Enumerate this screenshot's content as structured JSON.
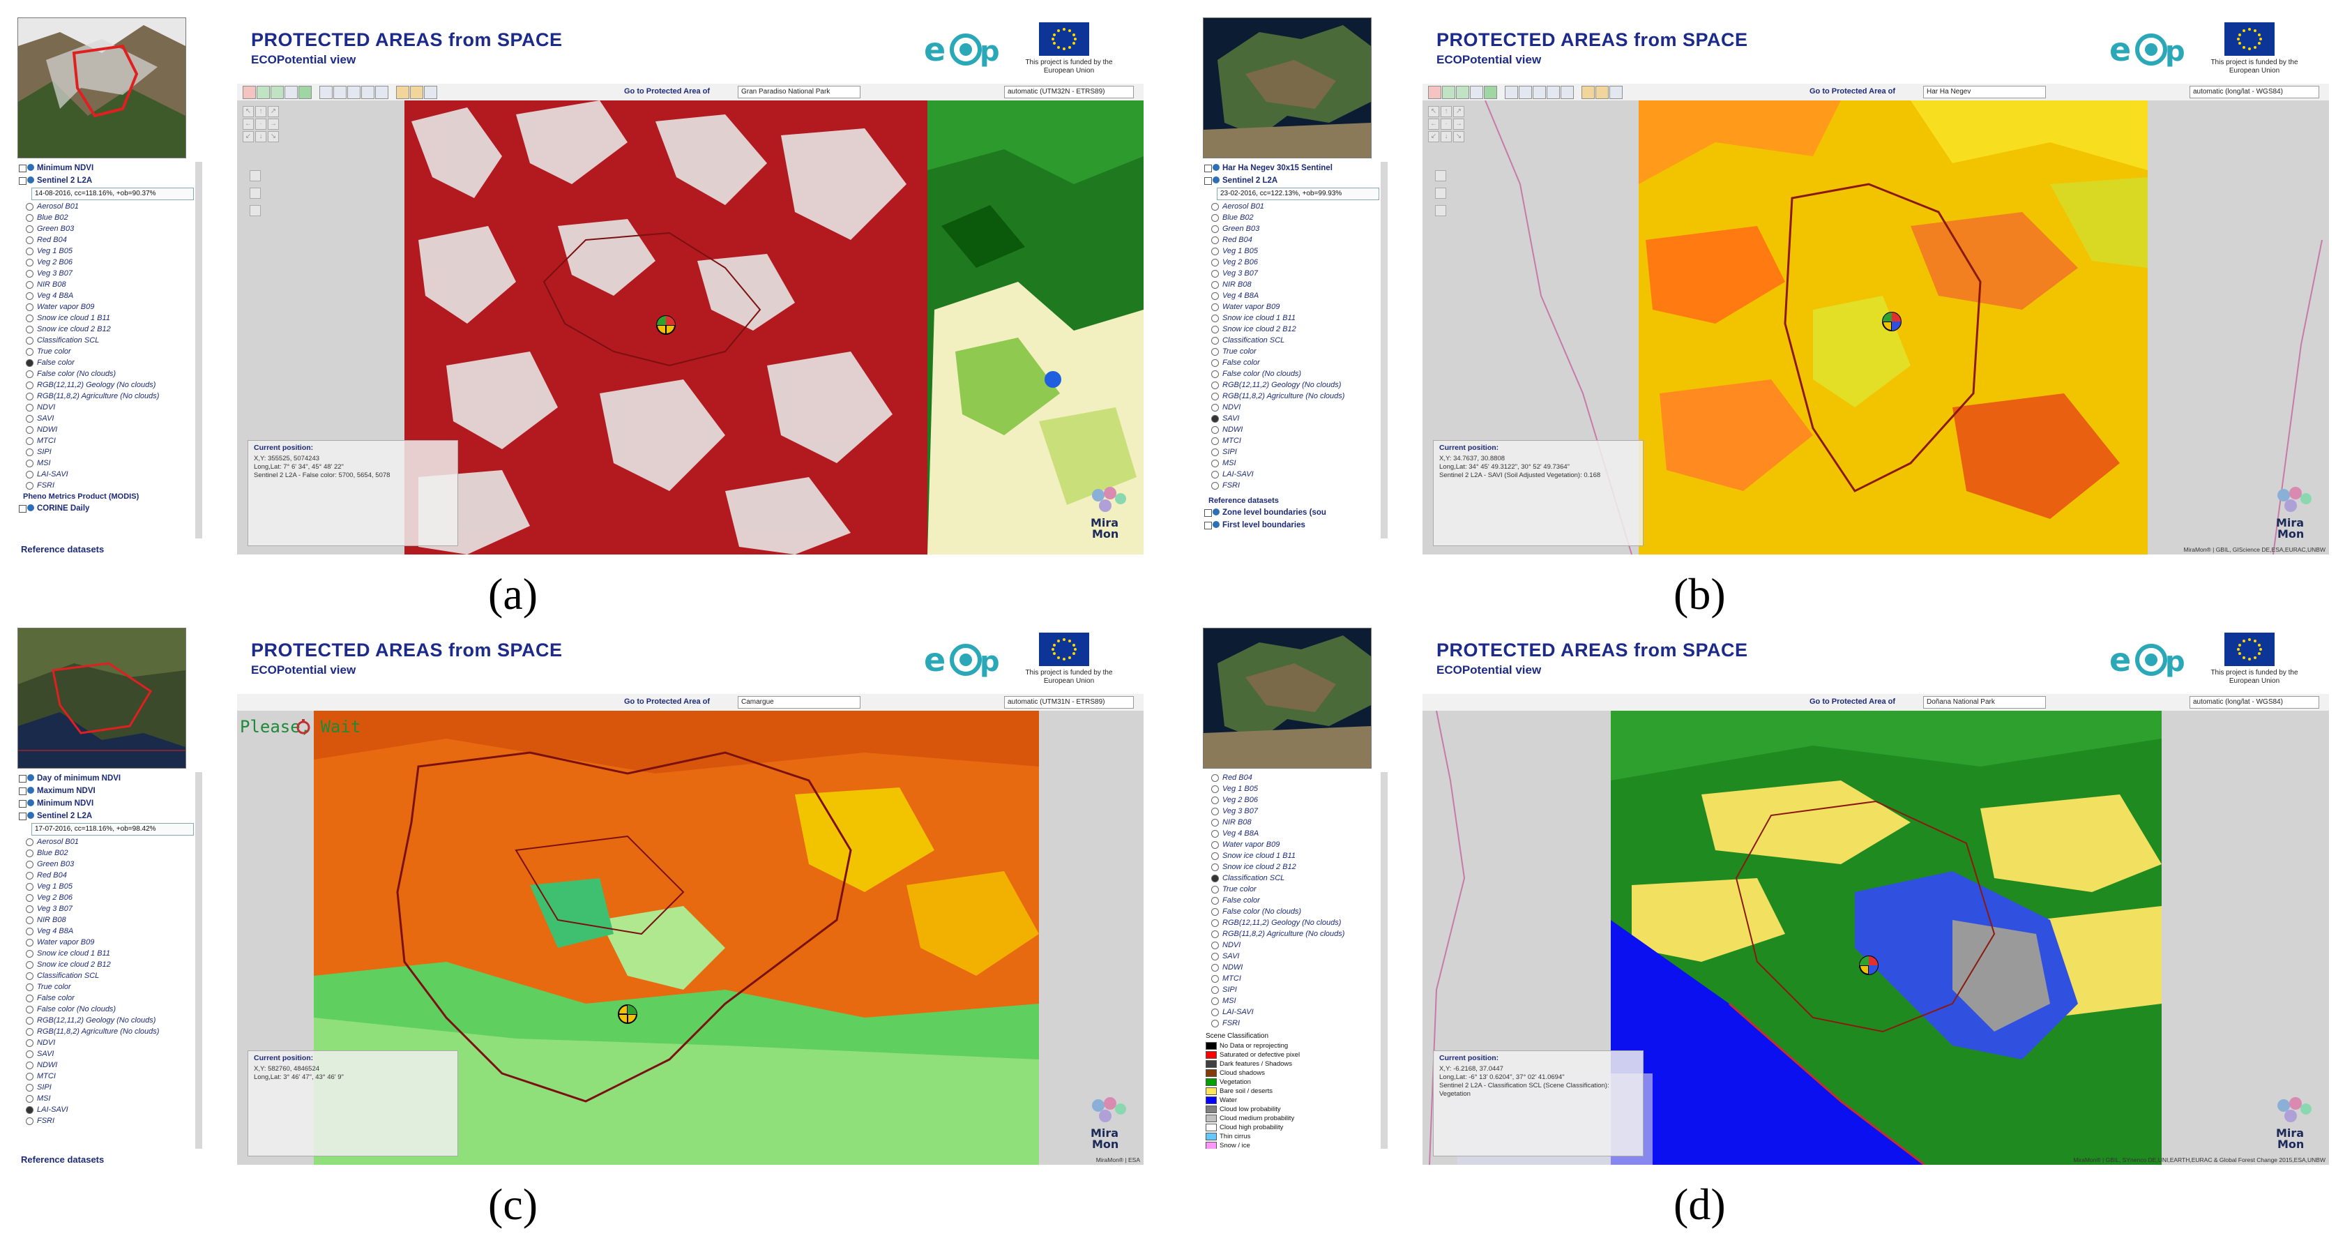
{
  "panels": {
    "a": {
      "caption": "(a)",
      "header": {
        "title": "PROTECTED AREAS from SPACE",
        "subtitle": "ECOPotential view"
      },
      "eu_text": "This project is funded by the European Union",
      "goto_label": "Go to Protected Area of",
      "goto_value": "Gran Paradiso National Park",
      "projection": "automatic (UTM32N - ETRS89)",
      "sidebar": {
        "groups": [
          "Minimum NDVI",
          "Sentinel 2 L2A"
        ],
        "date": "14-08-2016, cc=118.16%, +ob=90.37%",
        "layers": [
          "Aerosol B01",
          "Blue B02",
          "Green B03",
          "Red B04",
          "Veg 1 B05",
          "Veg 2 B06",
          "Veg 3 B07",
          "NIR B08",
          "Veg 4 B8A",
          "Water vapor B09",
          "Snow ice cloud 1 B11",
          "Snow ice cloud 2 B12",
          "Classification SCL",
          "True color",
          "False color",
          "False color (No clouds)",
          "RGB(12,11,2) Geology (No clouds)",
          "RGB(11,8,2) Agriculture (No clouds)",
          "NDVI",
          "SAVI",
          "NDWI",
          "MTCI",
          "SIPI",
          "MSI",
          "LAI-SAVI",
          "FSRI"
        ],
        "selected_layer": "False color",
        "pheno_title": "Pheno Metrics Product (MODIS)",
        "pheno_item": "CORINE Daily",
        "reference": "Reference datasets"
      },
      "position": {
        "title": "Current position:",
        "text": "X,Y: 355525, 5074243\nLong,Lat: 7° 6' 34\", 45° 48' 22\"\nSentinel 2 L2A - False color: 5700, 5654, 5078"
      },
      "credit": ""
    },
    "b": {
      "caption": "(b)",
      "header": {
        "title": "PROTECTED AREAS from SPACE",
        "subtitle": "ECOPotential view"
      },
      "eu_text": "This project is funded by the European Union",
      "goto_label": "Go to Protected Area of",
      "goto_value": "Har Ha Negev",
      "projection": "automatic (long/lat - WGS84)",
      "sidebar": {
        "groups": [
          "Har Ha Negev 30x15 Sentinel",
          "Sentinel 2 L2A"
        ],
        "date": "23-02-2016, cc=122.13%, +ob=99.93%",
        "layers": [
          "Aerosol B01",
          "Blue B02",
          "Green B03",
          "Red B04",
          "Veg 1 B05",
          "Veg 2 B06",
          "Veg 3 B07",
          "NIR B08",
          "Veg 4 B8A",
          "Water vapor B09",
          "Snow ice cloud 1 B11",
          "Snow ice cloud 2 B12",
          "Classification SCL",
          "True color",
          "False color",
          "False color (No clouds)",
          "RGB(12,11,2) Geology (No clouds)",
          "RGB(11,8,2) Agriculture (No clouds)",
          "NDVI",
          "SAVI",
          "NDWI",
          "MTCI",
          "SIPI",
          "MSI",
          "LAI-SAVI",
          "FSRI"
        ],
        "selected_layer": "SAVI",
        "reference": "Reference datasets",
        "ref_items": [
          "Zone level boundaries (sou",
          "First level boundaries"
        ]
      },
      "position": {
        "title": "Current position:",
        "text": "X,Y: 34.7637, 30.8808\nLong,Lat: 34° 45' 49.3122\", 30° 52' 49.7364\"\nSentinel 2 L2A - SAVI (Soil Adjusted Vegetation): 0.168"
      },
      "credit": "MiraMon® | GBIL, GIScience DE,ESA,EURAC,UNBW"
    },
    "c": {
      "caption": "(c)",
      "header": {
        "title": "PROTECTED AREAS from SPACE",
        "subtitle": "ECOPotential view"
      },
      "eu_text": "This project is funded by the European Union",
      "goto_label": "Go to Protected Area of",
      "goto_value": "Camargue",
      "projection": "automatic (UTM31N - ETRS89)",
      "please_wait": "Please, Wait",
      "sidebar": {
        "groups": [
          "Day of minimum NDVI",
          "Maximum NDVI",
          "Minimum NDVI",
          "Sentinel 2 L2A"
        ],
        "date": "17-07-2016, cc=118.16%, +ob=98.42%",
        "layers": [
          "Aerosol B01",
          "Blue B02",
          "Green B03",
          "Red B04",
          "Veg 1 B05",
          "Veg 2 B06",
          "Veg 3 B07",
          "NIR B08",
          "Veg 4 B8A",
          "Water vapor B09",
          "Snow ice cloud 1 B11",
          "Snow ice cloud 2 B12",
          "Classification SCL",
          "True color",
          "False color",
          "False color (No clouds)",
          "RGB(12,11,2) Geology (No clouds)",
          "RGB(11,8,2) Agriculture (No clouds)",
          "NDVI",
          "SAVI",
          "NDWI",
          "MTCI",
          "SIPI",
          "MSI",
          "LAI-SAVI",
          "FSRI"
        ],
        "selected_layer": "LAI-SAVI",
        "reference": "Reference datasets"
      },
      "position": {
        "title": "Current position:",
        "text": "X,Y: 582760, 4846524\nLong,Lat: 3° 46' 47\", 43° 46' 9\""
      },
      "credit": "MiraMon® | ESA"
    },
    "d": {
      "caption": "(d)",
      "header": {
        "title": "PROTECTED AREAS from SPACE",
        "subtitle": "ECOPotential view"
      },
      "eu_text": "This project is funded by the European Union",
      "goto_label": "Go to Protected Area of",
      "goto_value": "Doñana National Park",
      "projection": "automatic (long/lat - WGS84)",
      "sidebar": {
        "layers": [
          "Red B04",
          "Veg 1 B05",
          "Veg 2 B06",
          "Veg 3 B07",
          "NIR B08",
          "Veg 4 B8A",
          "Water vapor B09",
          "Snow ice cloud 1 B11",
          "Snow ice cloud 2 B12",
          "Classification SCL",
          "True color",
          "False color",
          "False color (No clouds)",
          "RGB(12,11,2) Geology (No clouds)",
          "RGB(11,8,2) Agriculture (No clouds)",
          "NDVI",
          "SAVI",
          "NDWI",
          "MTCI",
          "SIPI",
          "MSI",
          "LAI-SAVI",
          "FSRI"
        ],
        "selected_layer": "Classification SCL",
        "legend_title": "Scene Classification",
        "legend": [
          {
            "label": "No Data or reprojecting",
            "color": "#000000"
          },
          {
            "label": "Saturated or defective pixel",
            "color": "#ff0000"
          },
          {
            "label": "Dark features / Shadows",
            "color": "#404040"
          },
          {
            "label": "Cloud shadows",
            "color": "#833c0b"
          },
          {
            "label": "Vegetation",
            "color": "#00a000"
          },
          {
            "label": "Bare soil / deserts",
            "color": "#ffe65a"
          },
          {
            "label": "Water",
            "color": "#0000ff"
          },
          {
            "label": "Cloud low probability",
            "color": "#808080"
          },
          {
            "label": "Cloud medium probability",
            "color": "#c0c0c0"
          },
          {
            "label": "Cloud high probability",
            "color": "#ffffff"
          },
          {
            "label": "Thin cirrus",
            "color": "#64c8ff"
          },
          {
            "label": "Snow / ice",
            "color": "#ff96ff"
          }
        ]
      },
      "position": {
        "title": "Current position:",
        "text": "X,Y: -6.2168, 37.0447\nLong,Lat: -6° 13' 0.6204\", 37° 02' 41.0694\"\nSentinel 2 L2A - Classification SCL (Scene Classification):\nVegetation"
      },
      "credit": "MiraMon® | GBIL, SYnenco DE,UNI,EARTH,EURAC & Global Forest Change 2015,ESA,UNBW"
    }
  },
  "colors": {
    "title_blue": "#1c2a8a",
    "eu_blue": "#0d3597",
    "eu_gold": "#ffd700"
  }
}
